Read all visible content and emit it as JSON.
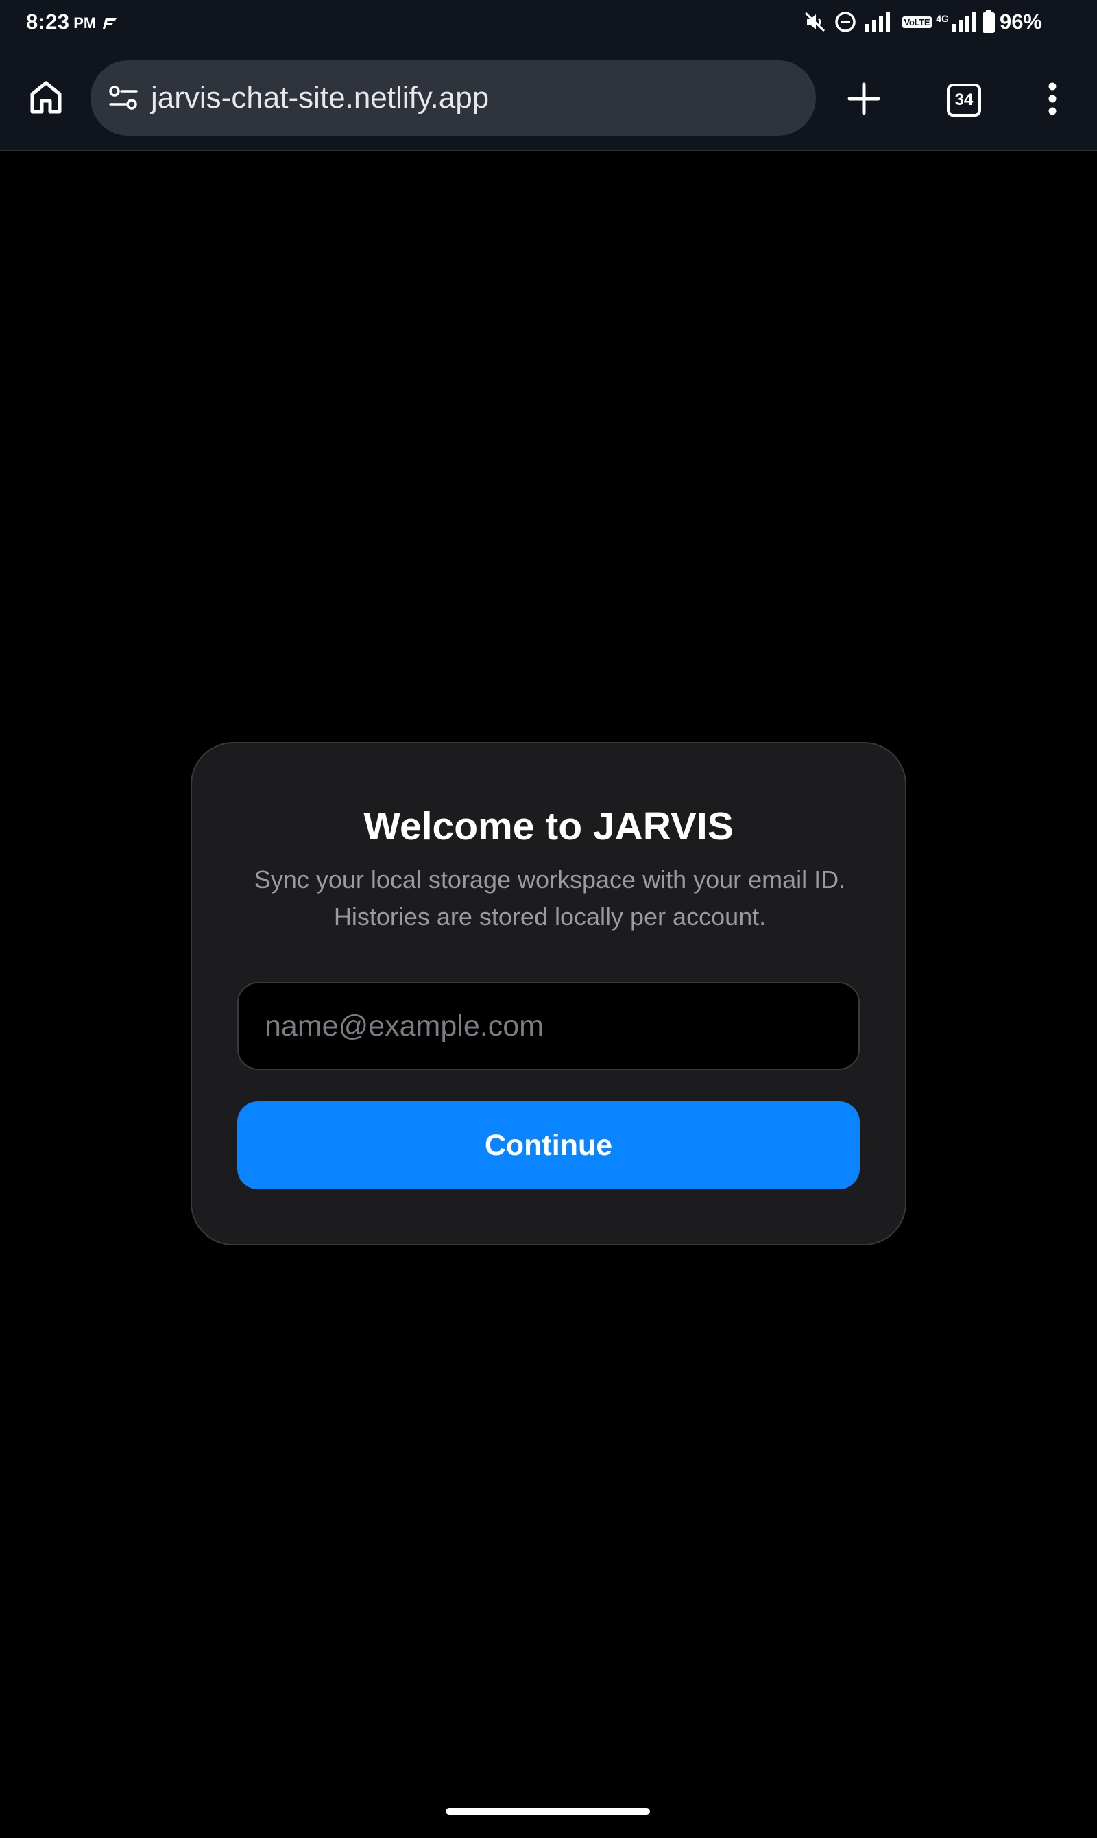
{
  "status_bar": {
    "time": "8:23",
    "ampm": "PM",
    "battery_percent": "96%",
    "network_label": "4G",
    "volte_label": "VoLTE",
    "icons": [
      "app-notification-icon",
      "mute-icon",
      "dnd-icon",
      "signal-icon",
      "signal-icon",
      "battery-icon"
    ]
  },
  "browser": {
    "url": "jarvis-chat-site.netlify.app",
    "tab_count": "34",
    "icons": {
      "home": "home-icon",
      "site_settings": "site-settings-icon",
      "new_tab": "plus-icon",
      "tabs": "tab-switcher-icon",
      "menu": "more-vert-icon"
    }
  },
  "login": {
    "title": "Welcome to JARVIS",
    "subtitle": "Sync your local storage workspace with your email ID. Histories are stored locally per account.",
    "email_value": "",
    "email_placeholder": "name@example.com",
    "continue_label": "Continue"
  },
  "colors": {
    "accent": "#0a84ff",
    "card_background": "#1c1c1e",
    "page_background": "#000000",
    "toolbar_background": "#0f141d",
    "url_bar_background": "#2f333b",
    "subtitle_text": "#9a9aa0"
  }
}
